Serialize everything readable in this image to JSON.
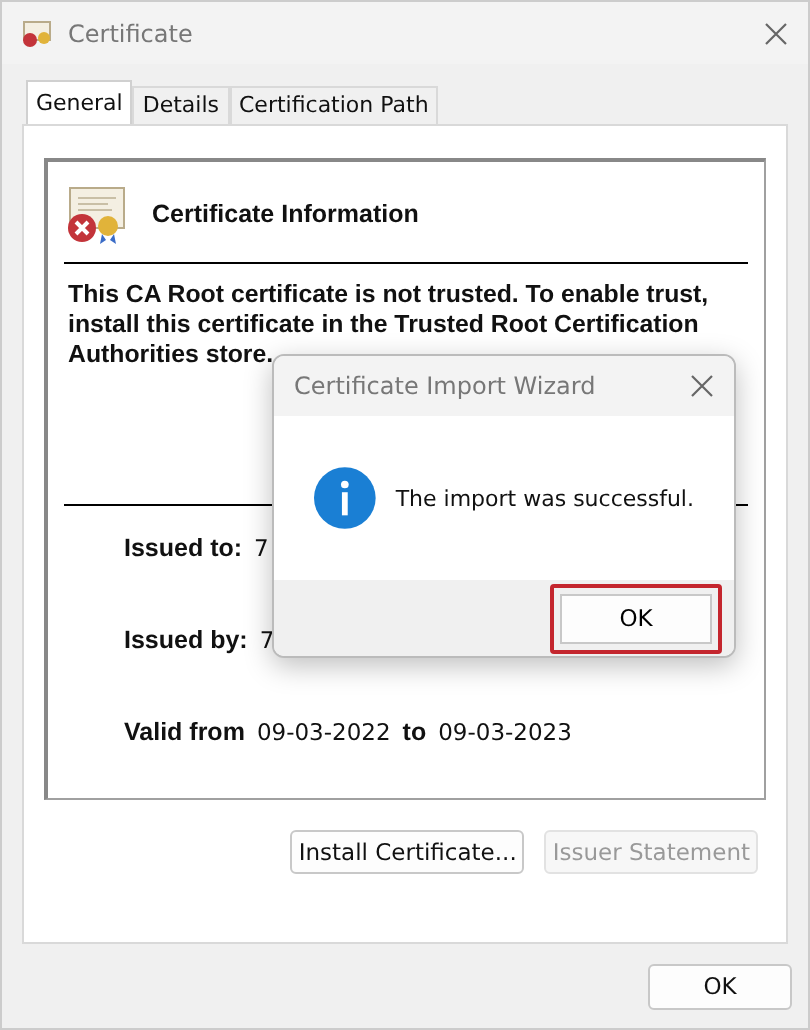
{
  "window": {
    "title": "Certificate"
  },
  "tabs": [
    {
      "label": "General",
      "selected": true
    },
    {
      "label": "Details",
      "selected": false
    },
    {
      "label": "Certification Path",
      "selected": false
    }
  ],
  "certificate": {
    "heading": "Certificate Information",
    "warning": "This CA Root certificate is not trusted. To enable trust, install this certificate in the Trusted Root Certification Authorities store.",
    "fields": [
      {
        "label": "Issued to:",
        "value": "7"
      },
      {
        "label": "Issued by:",
        "value": "7"
      }
    ],
    "valid": {
      "label": "Valid from",
      "from": "09-03-2022",
      "to_label": "to",
      "to": "09-03-2023"
    }
  },
  "buttons": [
    {
      "label": "Install Certificate...",
      "disabled": false
    },
    {
      "label": "Issuer Statement",
      "disabled": true
    }
  ],
  "footer_button": "OK",
  "dialog": {
    "title": "Certificate Import Wizard",
    "message": "The import was successful.",
    "button": {
      "label": "OK",
      "focused": true
    }
  }
}
